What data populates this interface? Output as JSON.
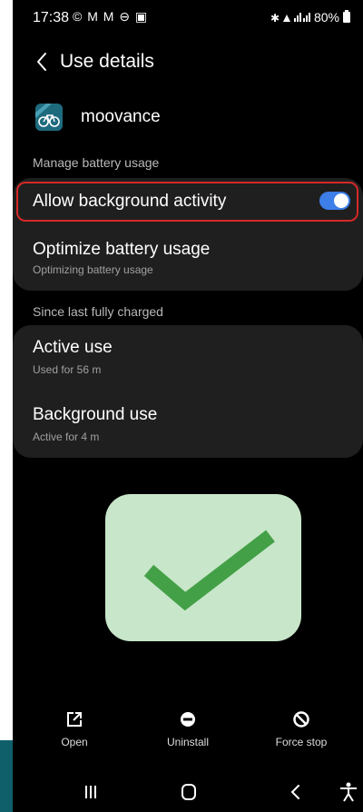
{
  "status_bar": {
    "time": "17:38",
    "left_icons": "© M M ⊖ ▣",
    "battery": "80%"
  },
  "header": {
    "title": "Use details"
  },
  "app": {
    "name": "moovance"
  },
  "sections": {
    "manage_battery": "Manage battery usage",
    "since_charged": "Since last fully charged"
  },
  "manage_items": [
    {
      "title": "Allow background activity",
      "enabled": true
    },
    {
      "title": "Optimize battery usage",
      "subtitle": "Optimizing battery usage"
    }
  ],
  "usage_items": [
    {
      "title": "Active use",
      "subtitle": "Used for 56 m"
    },
    {
      "title": "Background use",
      "subtitle": "Active for 4 m"
    }
  ],
  "actions": [
    {
      "label": "Open",
      "icon": "open-external-icon"
    },
    {
      "label": "Uninstall",
      "icon": "uninstall-icon"
    },
    {
      "label": "Force stop",
      "icon": "force-stop-icon"
    }
  ],
  "navbar": [
    "recents-icon",
    "home-icon",
    "back-icon",
    "accessibility-icon"
  ],
  "colors": {
    "toggle_on": "#3d7ee8",
    "highlight": "#d62828",
    "check_bg": "#c8e6c9",
    "check_mark": "#43a047"
  }
}
